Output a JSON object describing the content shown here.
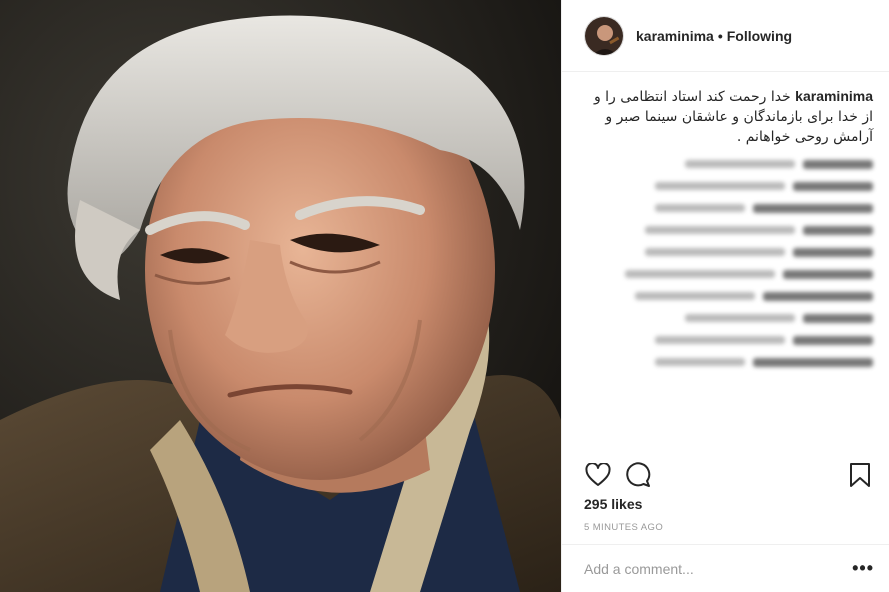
{
  "post": {
    "username": "karaminima",
    "separator": "•",
    "follow_label": "Following",
    "caption_user": "karaminima",
    "caption_text": "خدا رحمت کند استاد انتظامی را و از خدا برای بازماندگان و عاشقان سینما صبر و آرامش روحی خواهانم .",
    "likes": "295 likes",
    "timestamp": "5 MINUTES AGO",
    "add_comment_placeholder": "Add a comment...",
    "more_label": "•••",
    "icons": {
      "like": "heart-icon",
      "comment": "comment-icon",
      "save": "bookmark-icon",
      "more": "more-options-icon"
    },
    "photo": "portrait of an elderly man with grey hair"
  },
  "blurred_comments": [
    {
      "user": "",
      "text": ""
    },
    {
      "user": "",
      "text": ""
    },
    {
      "user": "",
      "text": ""
    },
    {
      "user": "",
      "text": ""
    },
    {
      "user": "",
      "text": ""
    },
    {
      "user": "",
      "text": ""
    },
    {
      "user": "",
      "text": ""
    },
    {
      "user": "",
      "text": ""
    },
    {
      "user": "",
      "text": ""
    },
    {
      "user": "",
      "text": ""
    }
  ],
  "colors": {
    "text": "#262626",
    "muted": "#999999",
    "border": "#efefef"
  }
}
